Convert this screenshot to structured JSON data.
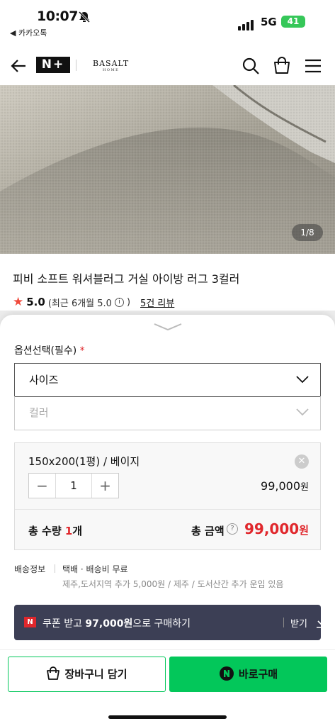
{
  "status_bar": {
    "time": "10:07",
    "back_app": "◀ 카카오톡",
    "network": "5G",
    "battery": "41"
  },
  "header": {
    "np_logo": "N+",
    "brand_name": "BASALT",
    "brand_sub": "HOME"
  },
  "hero": {
    "page_indicator": "1/8"
  },
  "product": {
    "title": "피비 소프트 워셔블러그 거실 아이방 러그 3컬러",
    "rating": "5.0",
    "rating_detail": "(최근 6개월 5.0",
    "rating_close": ")",
    "review_link": "5건 리뷰"
  },
  "options": {
    "title": "옵션선택(필수)",
    "required_mark": "*",
    "size_label": "사이즈",
    "color_label": "컬러"
  },
  "selected_item": {
    "name": "150x200(1평) / 베이지",
    "quantity": "1",
    "price": "99,000",
    "price_unit": "원",
    "minus": "−",
    "plus": "+"
  },
  "total": {
    "qty_label": "총 수량",
    "qty_value": "1",
    "qty_unit": "개",
    "amount_label": "총 금액",
    "amount": "99,000",
    "amount_unit": "원"
  },
  "shipping": {
    "label": "배송정보",
    "text": "택배 · 배송비 무료",
    "sub": "제주,도서지역 추가 5,000원 / 제주 / 도서산간 추가 운임 있음"
  },
  "coupon": {
    "badge": "N",
    "text_pre": "쿠폰 받고 ",
    "text_bold": "97,000원",
    "text_post": "으로 구매하기",
    "get_label": "받기"
  },
  "buttons": {
    "cart": "장바구니 담기",
    "buy": "바로구매"
  },
  "colors": {
    "naver_green": "#03c75a",
    "accent_red": "#e0272c",
    "coupon_bg": "#3c3f55"
  }
}
